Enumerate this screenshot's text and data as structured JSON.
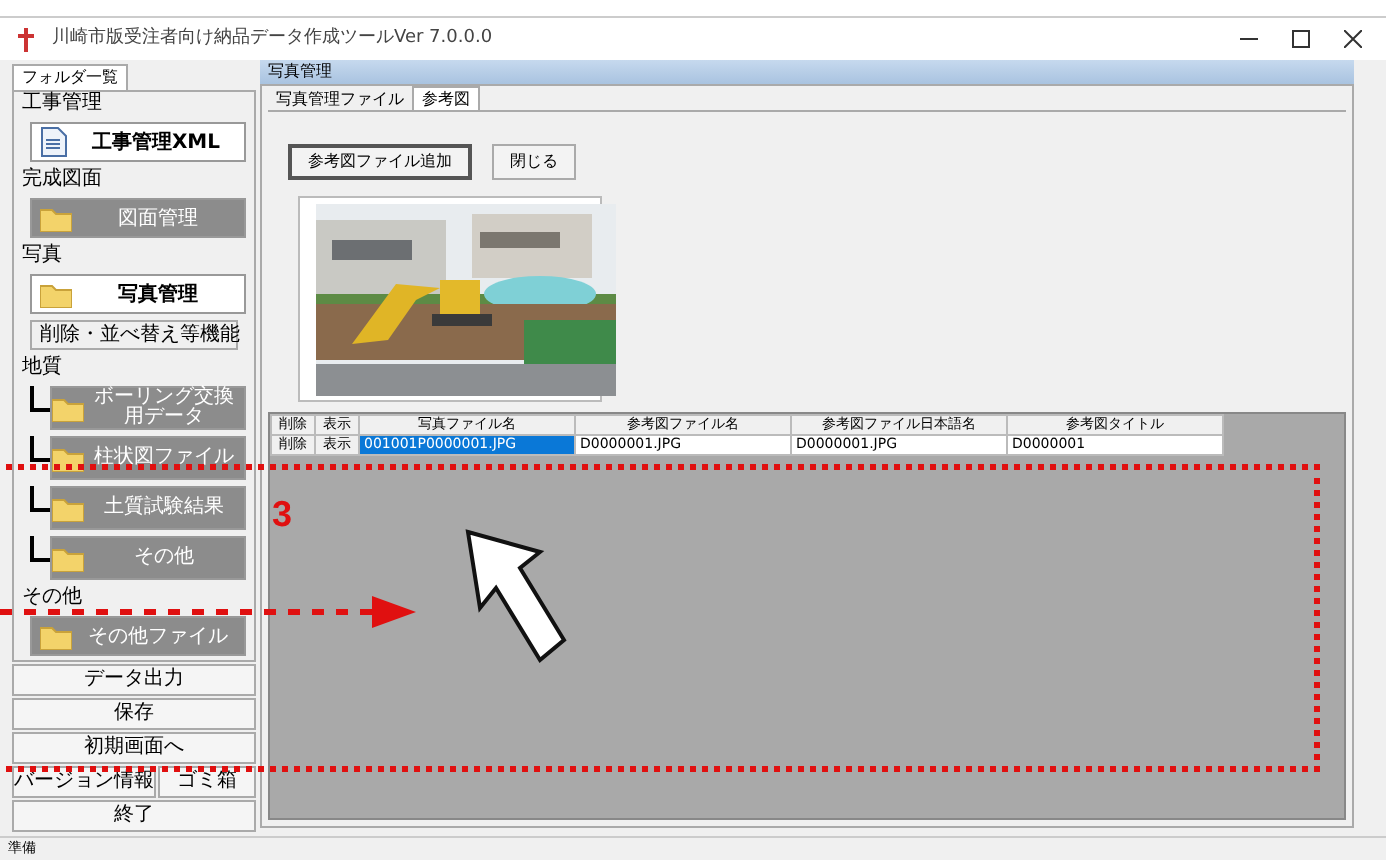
{
  "window": {
    "title": "川崎市版受注者向け納品データ作成ツールVer 7.0.0.0"
  },
  "sidebar": {
    "tab": "フォルダ一覧",
    "sections": [
      {
        "heading": "工事管理",
        "items": [
          {
            "kind": "document",
            "label": "工事管理XML",
            "enabled": true
          }
        ]
      },
      {
        "heading": "完成図面",
        "items": [
          {
            "kind": "folder",
            "label": "図面管理",
            "enabled": false
          }
        ]
      },
      {
        "heading": "写真",
        "items": [
          {
            "kind": "folder",
            "label": "写真管理",
            "enabled": true
          },
          {
            "kind": "button",
            "label": "削除・並べ替え等機能"
          }
        ]
      },
      {
        "heading": "地質",
        "items": [
          {
            "kind": "tree",
            "label": "ボーリング交換用データ"
          },
          {
            "kind": "tree",
            "label": "柱状図ファイル"
          },
          {
            "kind": "tree",
            "label": "土質試験結果"
          },
          {
            "kind": "tree",
            "label": "その他"
          }
        ]
      },
      {
        "heading": "その他",
        "items": [
          {
            "kind": "folder",
            "label": "その他ファイル",
            "enabled": false
          }
        ]
      }
    ],
    "buttons": [
      [
        "データ出力"
      ],
      [
        "保存"
      ],
      [
        "初期画面へ"
      ],
      [
        "バージョン情報",
        "ゴミ箱"
      ],
      [
        "終了"
      ]
    ]
  },
  "panel": {
    "title": "写真管理",
    "tabs": [
      {
        "label": "写真管理ファイル",
        "selected": false
      },
      {
        "label": "参考図",
        "selected": true
      }
    ],
    "buttons": [
      {
        "label": "参考図ファイル追加",
        "focused": true
      },
      {
        "label": "閉じる",
        "focused": false
      }
    ],
    "table": {
      "columns": [
        "削除",
        "表示",
        "写真ファイル名",
        "参考図ファイル名",
        "参考図ファイル日本語名",
        "参考図タイトル"
      ],
      "rows": [
        {
          "cells": [
            {
              "text": "削除",
              "kind": "button",
              "selected": false
            },
            {
              "text": "表示",
              "kind": "button",
              "selected": false
            },
            {
              "text": "001001P0000001.JPG",
              "kind": "text",
              "selected": true
            },
            {
              "text": "D0000001.JPG",
              "kind": "text",
              "selected": false
            },
            {
              "text": "D0000001.JPG",
              "kind": "text",
              "selected": false
            },
            {
              "text": "D0000001",
              "kind": "text",
              "selected": false
            }
          ]
        }
      ]
    }
  },
  "annotation": {
    "label": "3"
  },
  "status_bar": "準備"
}
